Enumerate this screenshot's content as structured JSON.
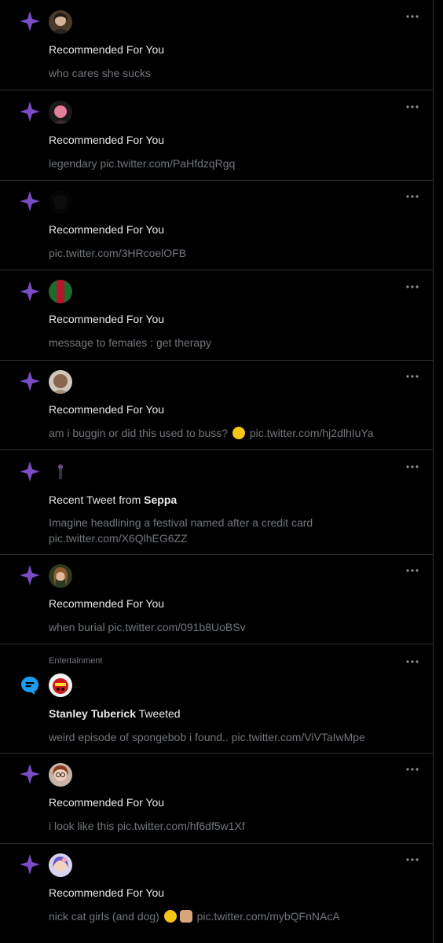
{
  "colors": {
    "background": "#000000",
    "divider": "#2f3336",
    "primary_text": "#e7e9ea",
    "secondary_text": "#71767b",
    "recommend_star": "#794bc4",
    "topic_bubble": "#1d9bf0"
  },
  "notifications": [
    {
      "icon": "sparkle-icon",
      "title": "Recommended For You",
      "text": "who cares she sucks"
    },
    {
      "icon": "sparkle-icon",
      "title": "Recommended For You",
      "text": "legendary pic.twitter.com/PaHfdzqRgq"
    },
    {
      "icon": "sparkle-icon",
      "title": "Recommended For You",
      "text": "pic.twitter.com/3HRcoelOFB"
    },
    {
      "icon": "sparkle-icon",
      "title": "Recommended For You",
      "text": "message to females : get therapy"
    },
    {
      "icon": "sparkle-icon",
      "title": "Recommended For You",
      "text_before_emoji": "am i buggin or did this used to buss?",
      "emoji": "raised-eyebrow-face",
      "text_after_emoji": "pic.twitter.com/hj2dlhIuYa"
    },
    {
      "icon": "sparkle-icon",
      "title_prefix": "Recent Tweet from",
      "title_name": "Seppa",
      "text_line1": "Imagine headlining a festival named after a credit card",
      "text_line2": "pic.twitter.com/X6QlhEG6ZZ"
    },
    {
      "icon": "sparkle-icon",
      "title": "Recommended For You",
      "text": "when burial pic.twitter.com/091b8UoBSv"
    },
    {
      "icon": "topic-bubble-icon",
      "topic": "Entertainment",
      "title_name": "Stanley Tuberick",
      "title_suffix": "Tweeted",
      "text": "weird episode of spongebob i found.. pic.twitter.com/ViVTaIwMpe"
    },
    {
      "icon": "sparkle-icon",
      "title": "Recommended For You",
      "text": "i look like this pic.twitter.com/hf6df5w1Xf"
    },
    {
      "icon": "sparkle-icon",
      "title": "Recommended For You",
      "text_before_emoji": "nick cat girls (and dog)",
      "emoji": "grinning-face thumbs-up",
      "text_after_emoji": "pic.twitter.com/mybQFnNAcA"
    }
  ]
}
